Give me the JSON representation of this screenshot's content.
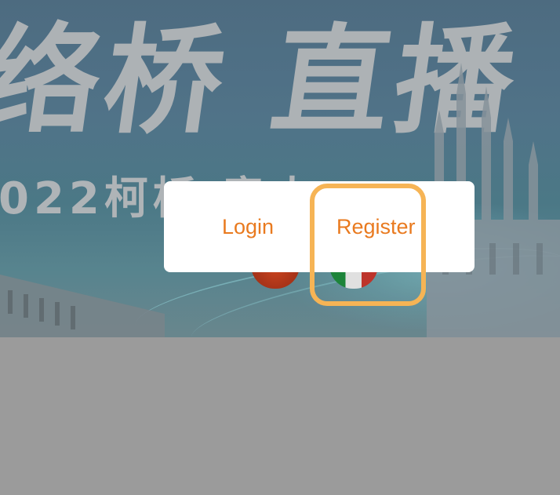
{
  "banner": {
    "calligraphy_text": "络桥 直播",
    "subtitle_text": "022柯桥 意大"
  },
  "dialog": {
    "login_label": "Login",
    "register_label": "Register"
  },
  "colors": {
    "accent": "#e97a1f",
    "highlight": "#f6b455",
    "backdrop": "#9b9b9b"
  },
  "flags": [
    "flag-red-icon",
    "flag-italy-icon"
  ]
}
